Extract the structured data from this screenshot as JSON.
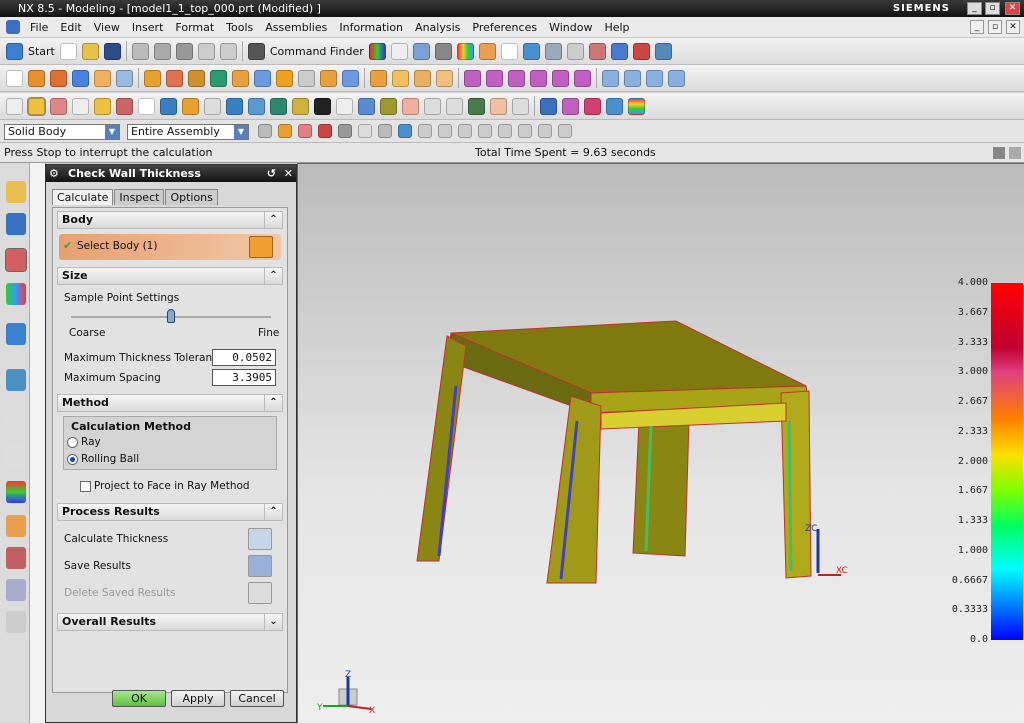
{
  "window": {
    "title": "NX 8.5 - Modeling - [model1_1_top_000.prt (Modified) ]",
    "brand": "SIEMENS"
  },
  "menu": [
    "File",
    "Edit",
    "View",
    "Insert",
    "Format",
    "Tools",
    "Assemblies",
    "Information",
    "Analysis",
    "Preferences",
    "Window",
    "Help"
  ],
  "toolbar": {
    "start_label": "Start",
    "command_finder_label": "Command Finder"
  },
  "selection": {
    "filter": "Solid Body",
    "scope": "Entire Assembly"
  },
  "status": {
    "message": "Press Stop to interrupt the calculation",
    "time": "Total Time Spent = 9.63 seconds"
  },
  "dialog": {
    "title": "Check Wall Thickness",
    "tabs": [
      "Calculate",
      "Inspect",
      "Options"
    ],
    "body": {
      "header": "Body",
      "select_label": "Select Body (1)"
    },
    "size": {
      "header": "Size",
      "sample_label": "Sample Point Settings",
      "slider_value": 0.5,
      "coarse": "Coarse",
      "fine": "Fine",
      "tol_label": "Maximum Thickness Tolerance",
      "tol_value": "0.0502",
      "spacing_label": "Maximum Spacing",
      "spacing_value": "3.3905"
    },
    "method": {
      "header": "Method",
      "calc_label": "Calculation Method",
      "options": [
        "Ray",
        "Rolling Ball"
      ],
      "selected": "Rolling Ball",
      "project_label": "Project to Face in Ray Method",
      "project_checked": false
    },
    "process": {
      "header": "Process Results",
      "calculate": "Calculate Thickness",
      "save": "Save Results",
      "delete": "Delete Saved Results"
    },
    "overall": {
      "header": "Overall Results"
    },
    "buttons": {
      "ok": "OK",
      "apply": "Apply",
      "cancel": "Cancel"
    }
  },
  "viewport": {
    "legend": [
      "4.000",
      "3.667",
      "3.333",
      "3.000",
      "2.667",
      "2.333",
      "2.000",
      "1.667",
      "1.333",
      "1.000",
      "0.6667",
      "0.3333",
      "0.0"
    ],
    "axes": {
      "x": "XC",
      "z": "ZC"
    },
    "triad": {
      "x": "X",
      "y": "Y",
      "z": "Z"
    }
  }
}
